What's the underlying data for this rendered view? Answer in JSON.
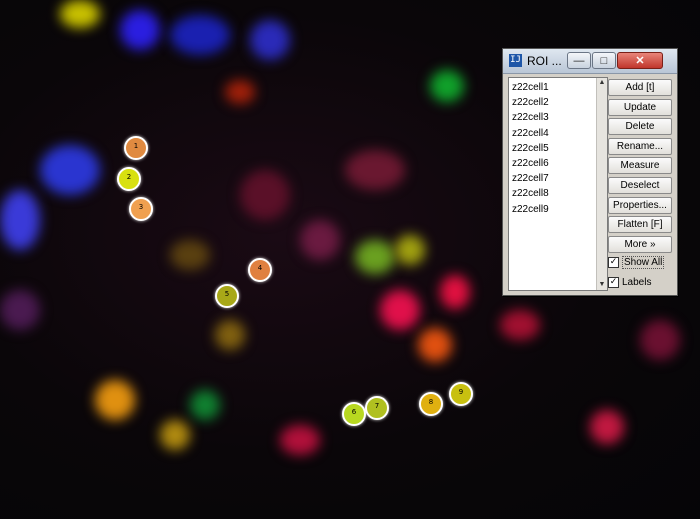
{
  "window": {
    "title": "ROI ...",
    "app_icon": "imagej-icon",
    "controls": {
      "minimize": "minimize-icon",
      "maximize": "maximize-icon",
      "close": "close-icon"
    }
  },
  "roi_list": [
    "z22cell1",
    "z22cell2",
    "z22cell3",
    "z22cell4",
    "z22cell5",
    "z22cell6",
    "z22cell7",
    "z22cell8",
    "z22cell9"
  ],
  "buttons": [
    "Add [t]",
    "Update",
    "Delete",
    "Rename...",
    "Measure",
    "Deselect",
    "Properties...",
    "Flatten [F]",
    "More »"
  ],
  "checkboxes": {
    "show_all": {
      "label": "Show All",
      "checked": true
    },
    "labels": {
      "label": "Labels",
      "checked": true
    }
  },
  "roi_markers": [
    "1",
    "2",
    "3",
    "4",
    "5",
    "6",
    "7",
    "8",
    "9"
  ],
  "colors": {
    "roi_outline": "#ffffff",
    "titlebar": "#c9d4e2",
    "close_button": "#c0362c"
  }
}
